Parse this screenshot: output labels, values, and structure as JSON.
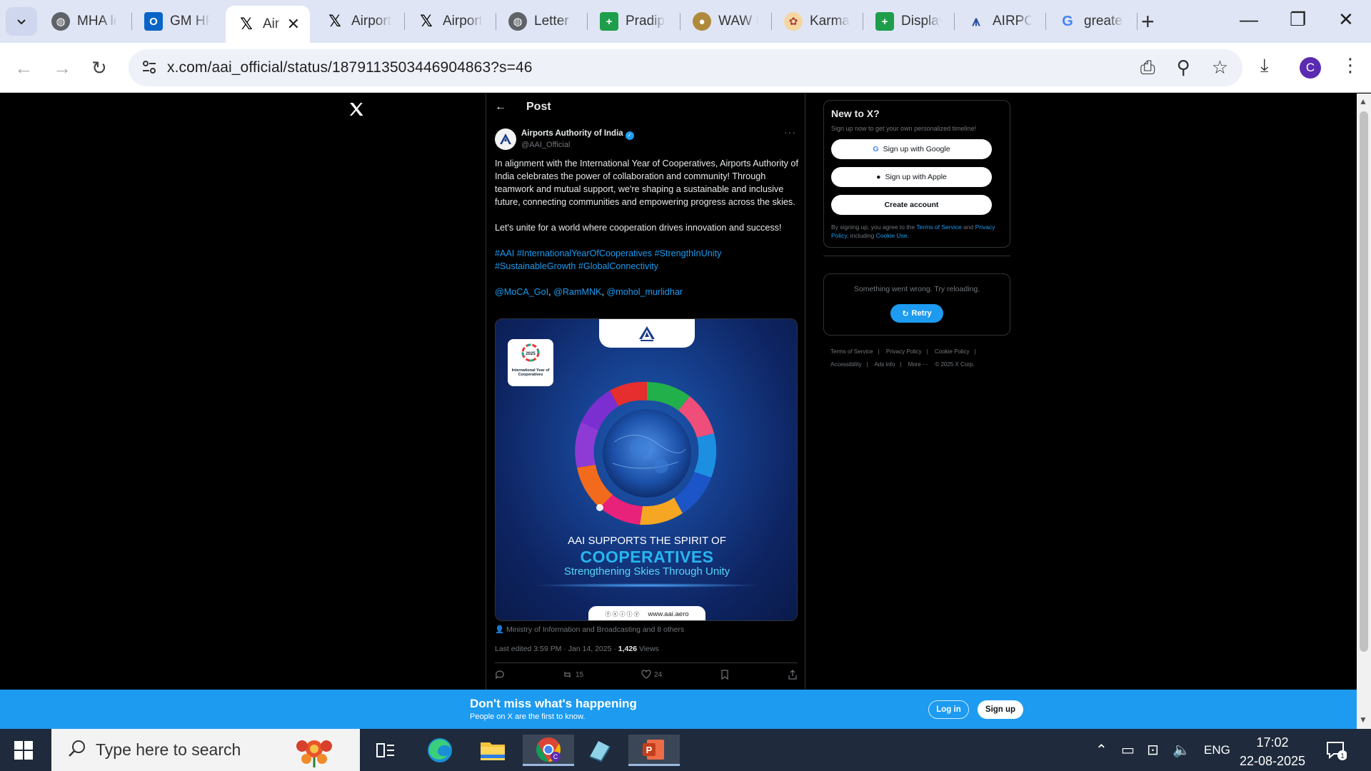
{
  "browser": {
    "tabs": [
      {
        "title": "MHA le",
        "icon": "globe-icon"
      },
      {
        "title": "GM HR",
        "icon": "outlook-icon"
      },
      {
        "title": "Air",
        "icon": "x-logo-icon",
        "active": true
      },
      {
        "title": "Airport",
        "icon": "x-logo-icon"
      },
      {
        "title": "Airport",
        "icon": "x-logo-icon"
      },
      {
        "title": "Letter r",
        "icon": "globe-icon"
      },
      {
        "title": "Pradipt",
        "icon": "sheets-icon"
      },
      {
        "title": "WAW F",
        "icon": "site-icon"
      },
      {
        "title": "Karmay",
        "icon": "karmayogi-icon"
      },
      {
        "title": "Display",
        "icon": "sheets-icon"
      },
      {
        "title": "AIRPOF",
        "icon": "aai-icon"
      },
      {
        "title": "greater",
        "icon": "google-icon"
      }
    ],
    "url": "x.com/aai_official/status/1879113503446904863?s=46",
    "profile_initial": "C"
  },
  "post": {
    "header_title": "Post",
    "author_name": "Airports Authority of India",
    "author_handle": "@AAI_Official",
    "paragraph1": "In alignment with the International Year of Cooperatives, Airports Authority of India celebrates the power of collaboration and community! Through teamwork and mutual support, we're shaping a sustainable and inclusive future, connecting communities and empowering progress across the skies.",
    "paragraph2": "Let's unite for a world where cooperation drives innovation and success!",
    "hashtags_line1": "#AAI #InternationalYearOfCooperatives #StrengthInUnity",
    "hashtags_line2": "#SustainableGrowth #GlobalConnectivity",
    "mention1": "@MoCA_GoI",
    "mention2": "@RamMNK",
    "mention3": "@mohol_murlidhar",
    "media": {
      "iyc_year": "2025",
      "iyc_title": "International Year of Cooperatives",
      "line1": "AAI SUPPORTS THE SPIRIT OF",
      "line2": "COOPERATIVES",
      "line3": "Strengthening Skies Through Unity",
      "website": "www.aai.aero"
    },
    "tagged": "Ministry of Information and Broadcasting and 8 others",
    "edited": "Last edited 3:59 PM · Jan 14, 2025 · ",
    "views_count": "1,426",
    "views_label": " Views",
    "reposts": "15",
    "likes": "24"
  },
  "sidebar": {
    "new_title": "New to X?",
    "new_sub": "Sign up now to get your own personalized timeline!",
    "google_btn": "Sign up with Google",
    "apple_btn": "Sign up with Apple",
    "create_btn": "Create account",
    "legal_a": "By signing up, you agree to the ",
    "legal_tos": "Terms of Service",
    "legal_b": " and ",
    "legal_privacy": "Privacy Policy",
    "legal_c": ", including ",
    "legal_cookie": "Cookie Use",
    "legal_d": ".",
    "error_msg": "Something went wrong. Try reloading.",
    "retry": "Retry",
    "footer": [
      "Terms of Service",
      "|",
      "Privacy Policy",
      "|",
      "Cookie Policy",
      "|",
      "Accessibility",
      "|",
      "Ads info",
      "|",
      "More ···",
      "© 2025 X Corp."
    ]
  },
  "banner": {
    "title": "Don't miss what's happening",
    "subtitle": "People on X are the first to know.",
    "login": "Log in",
    "signup": "Sign up"
  },
  "taskbar": {
    "search_placeholder": "Type here to search",
    "lang": "ENG",
    "time": "17:02",
    "date": "22-08-2025",
    "notifications": "1"
  },
  "colors": {
    "x_blue": "#1d9bf0",
    "chrome_tab_strip": "#dfe5f4",
    "taskbar": "#1f2b3c"
  }
}
